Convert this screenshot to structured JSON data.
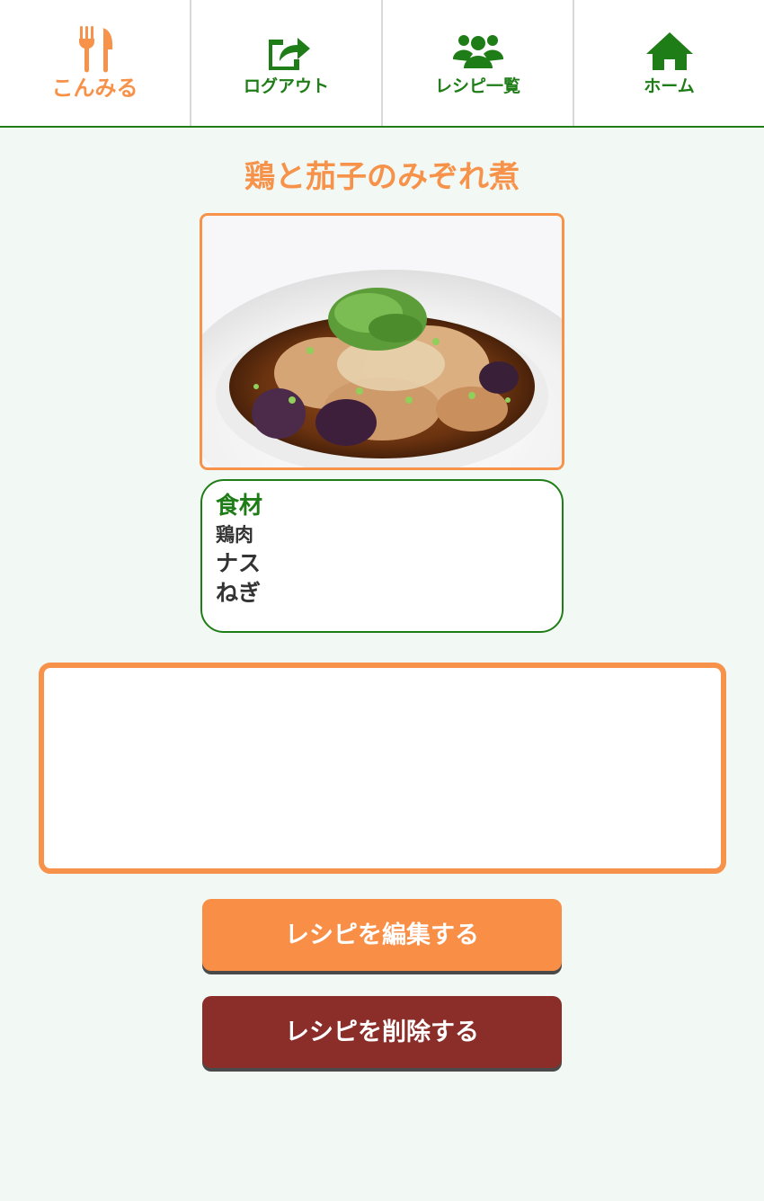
{
  "nav": {
    "brand_label": "こんみる",
    "logout_label": "ログアウト",
    "recipes_label": "レシピ一覧",
    "home_label": "ホーム"
  },
  "recipe": {
    "title": "鶏と茄子のみぞれ煮",
    "photo_icon": "dish-photo",
    "ingredients_heading": "食材",
    "ingredients": [
      "鶏肉",
      "ナス",
      "ねぎ"
    ],
    "memo": ""
  },
  "actions": {
    "edit_label": "レシピを編集する",
    "delete_label": "レシピを削除する"
  },
  "colors": {
    "accent_orange": "#f7924a",
    "brand_green": "#1f7d17",
    "danger": "#8b2d28",
    "background": "#f2f8f3"
  }
}
